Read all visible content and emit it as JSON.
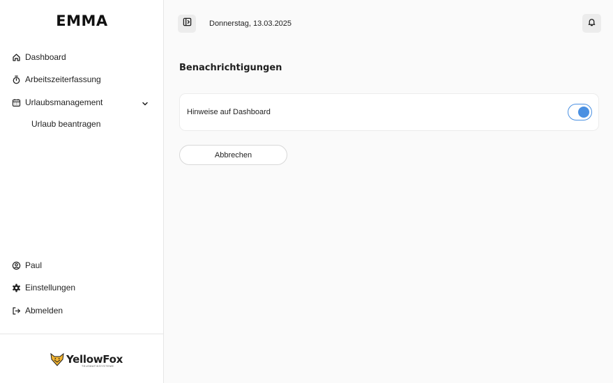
{
  "app": {
    "title": "EMMA"
  },
  "sidebar": {
    "nav": [
      {
        "label": "Dashboard",
        "icon": "home-icon"
      },
      {
        "label": "Arbeitszeiterfassung",
        "icon": "stopwatch-icon"
      },
      {
        "label": "Urlaubsmanagement",
        "icon": "calendar-icon",
        "expanded": true
      }
    ],
    "subnav": [
      {
        "label": "Urlaub beantragen"
      }
    ],
    "bottom": [
      {
        "label": "Paul",
        "icon": "user-circle-icon"
      },
      {
        "label": "Einstellungen",
        "icon": "gear-icon"
      },
      {
        "label": "Abmelden",
        "icon": "logout-icon"
      }
    ],
    "logo": {
      "name": "YellowFox",
      "sub": "TELEMATIKSYSTEME",
      "mark": "fox-logo-icon"
    }
  },
  "header": {
    "date": "Donnerstag, 13.03.2025",
    "panel_toggle_icon": "sidebar-toggle-icon",
    "bell_icon": "bell-icon"
  },
  "main": {
    "title": "Benachrichtigungen",
    "settings": [
      {
        "label": "Hinweise auf Dashboard",
        "enabled": true
      }
    ],
    "cancel_label": "Abbrechen"
  },
  "colors": {
    "accent": "#4a90e2",
    "background": "#fafafa",
    "sidebar": "#ffffff",
    "fox": "#f2b431"
  }
}
